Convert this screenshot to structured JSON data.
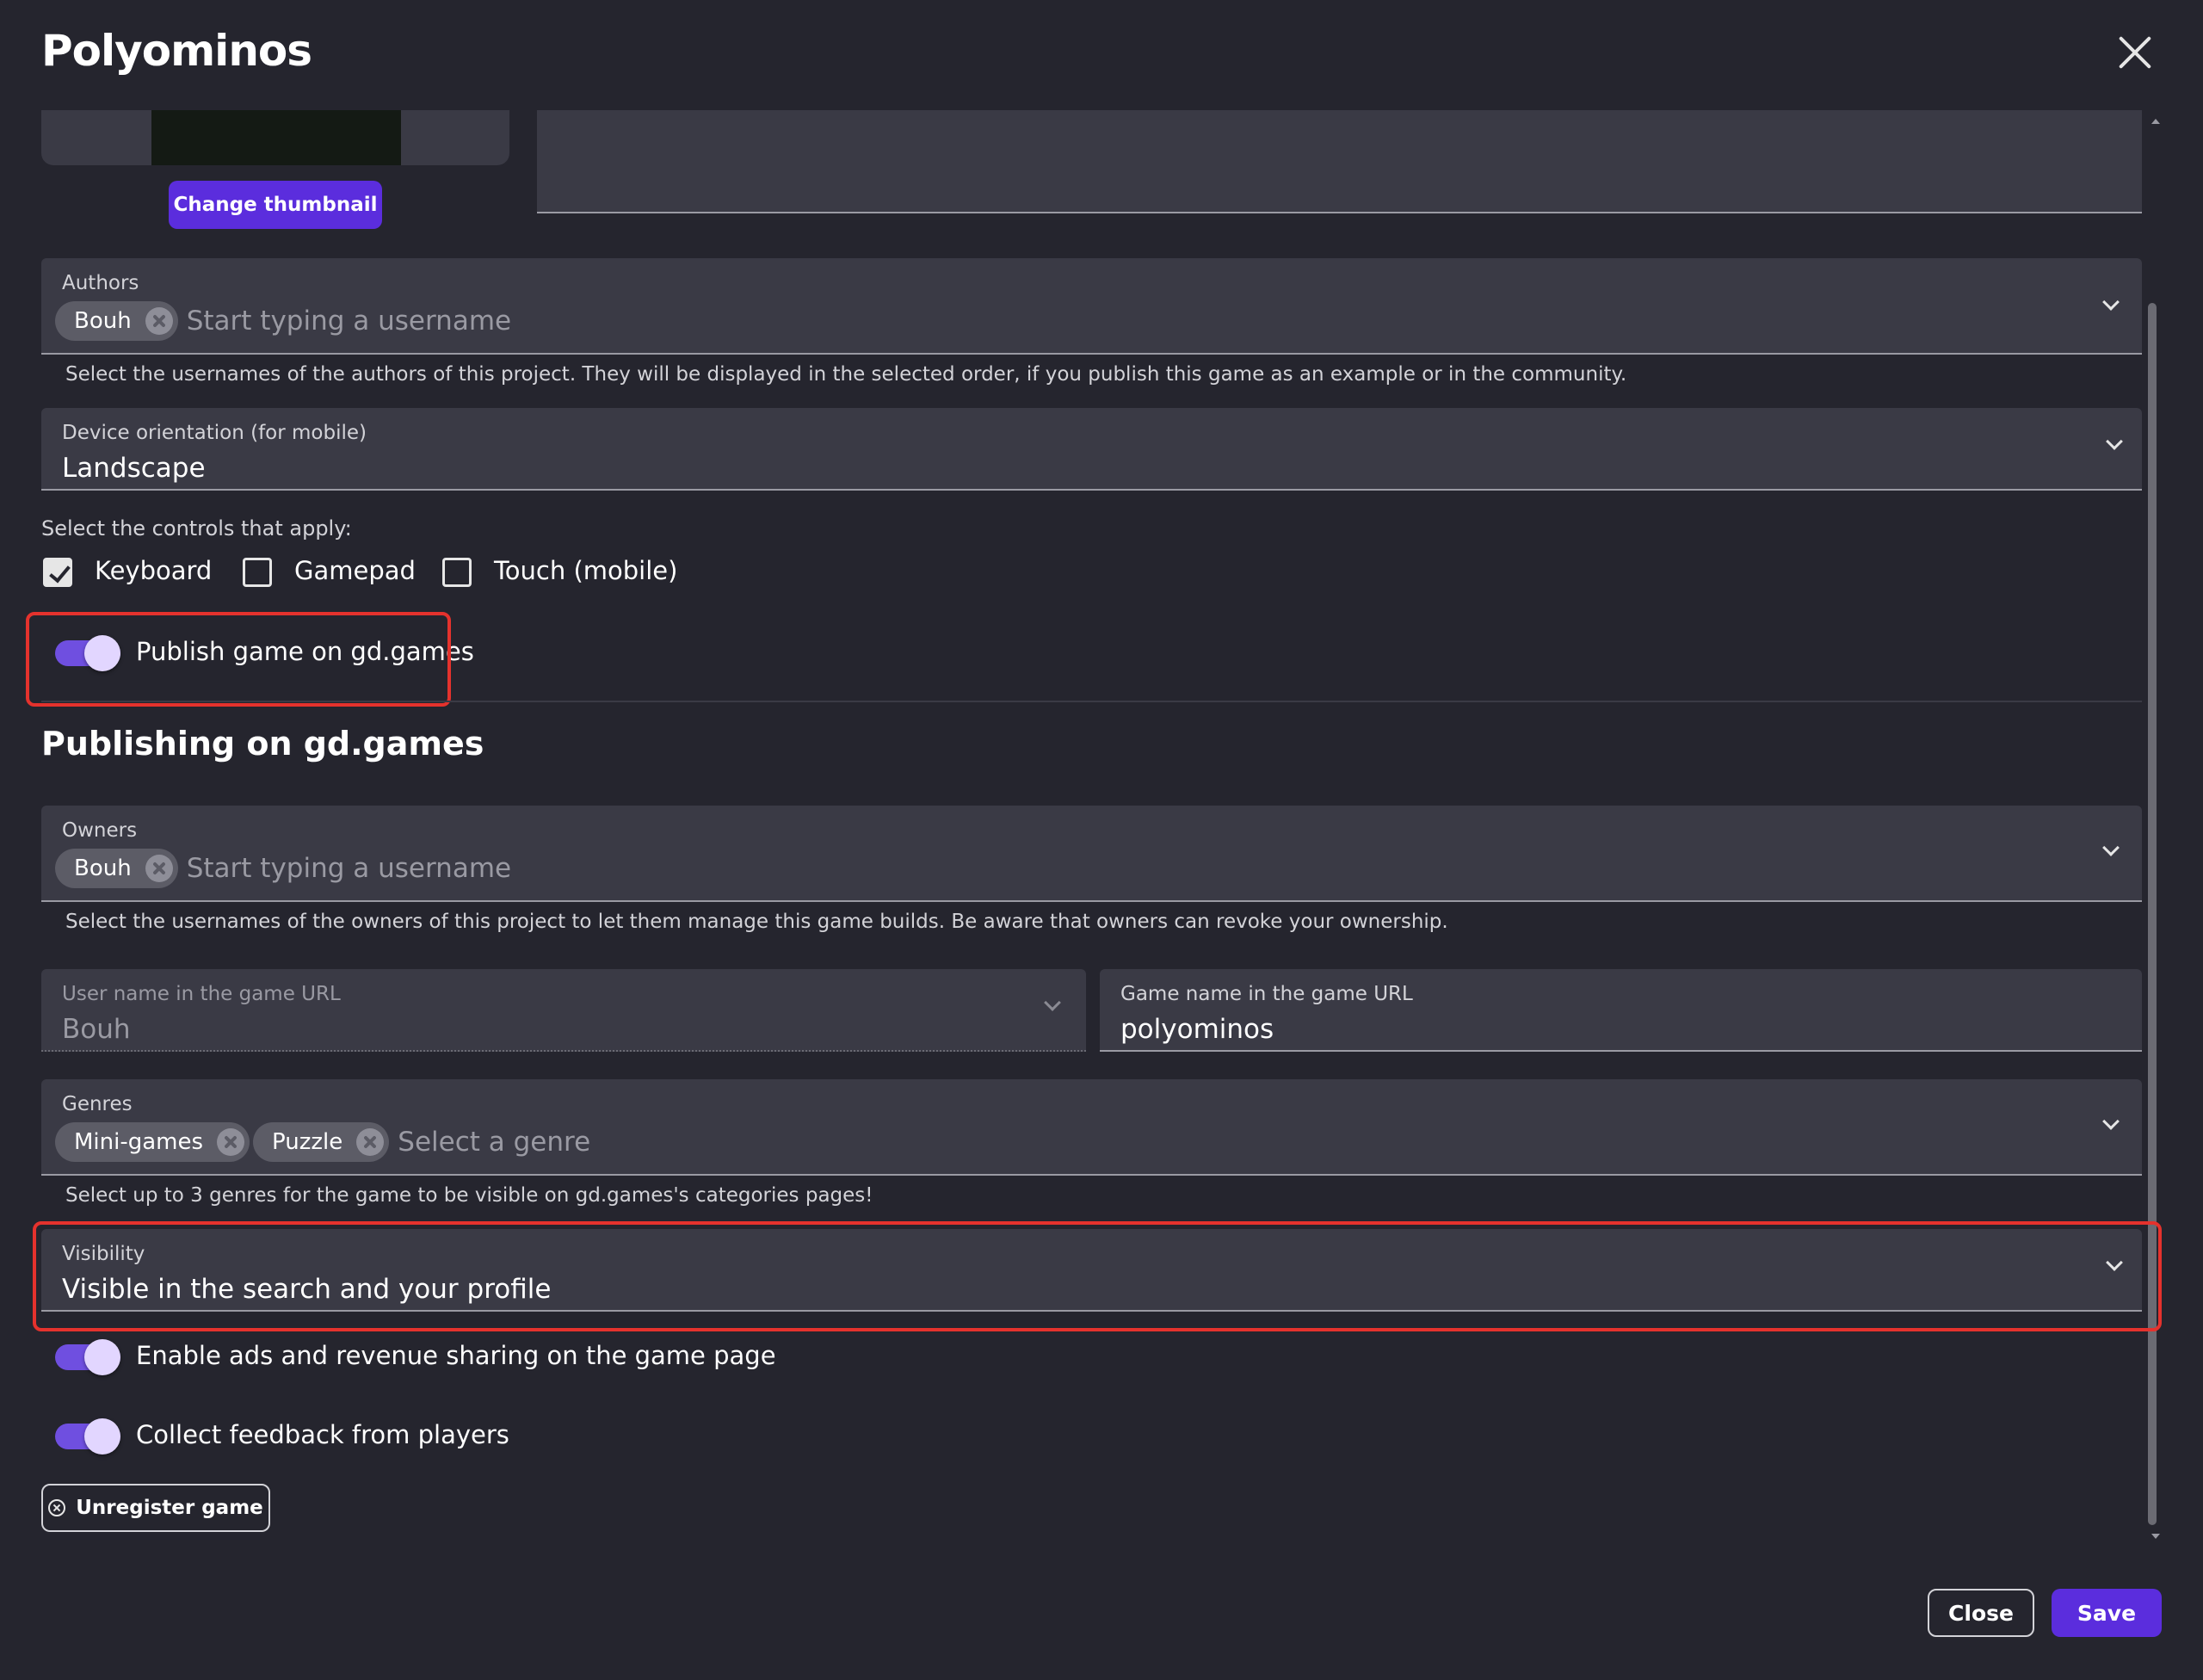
{
  "dialog": {
    "title": "Polyominos"
  },
  "thumbnail": {
    "change_button": "Change thumbnail"
  },
  "authors": {
    "label": "Authors",
    "chips": [
      "Bouh"
    ],
    "placeholder": "Start typing a username",
    "helper": "Select the usernames of the authors of this project. They will be displayed in the selected order, if you publish this game as an example or in the community."
  },
  "orientation": {
    "label": "Device orientation (for mobile)",
    "value": "Landscape"
  },
  "controls": {
    "label": "Select the controls that apply:",
    "options": [
      {
        "label": "Keyboard",
        "checked": true
      },
      {
        "label": "Gamepad",
        "checked": false
      },
      {
        "label": "Touch (mobile)",
        "checked": false
      }
    ]
  },
  "publish_toggle": {
    "label": "Publish game on gd.games",
    "on": true
  },
  "publishing": {
    "heading": "Publishing on gd.games",
    "owners": {
      "label": "Owners",
      "chips": [
        "Bouh"
      ],
      "placeholder": "Start typing a username",
      "helper": "Select the usernames of the owners of this project to let them manage this game builds. Be aware that owners can revoke your ownership."
    },
    "user_url": {
      "label": "User name in the game URL",
      "value": "Bouh"
    },
    "game_url": {
      "label": "Game name in the game URL",
      "value": "polyominos"
    },
    "genres": {
      "label": "Genres",
      "chips": [
        "Mini-games",
        "Puzzle"
      ],
      "placeholder": "Select a genre",
      "helper": "Select up to 3 genres for the game to be visible on gd.games's categories pages!"
    },
    "visibility": {
      "label": "Visibility",
      "value": "Visible in the search and your profile"
    },
    "ads_toggle": {
      "label": "Enable ads and revenue sharing on the game page",
      "on": true
    },
    "feedback_toggle": {
      "label": "Collect feedback from players",
      "on": true
    },
    "unregister_button": "Unregister game"
  },
  "footer": {
    "close_label": "Close",
    "save_label": "Save"
  },
  "colors": {
    "background": "#25252e",
    "field": "#3a3a45",
    "primary": "#5b2ddd",
    "toggle": "#6f4fe0",
    "highlight": "#e5322d"
  }
}
